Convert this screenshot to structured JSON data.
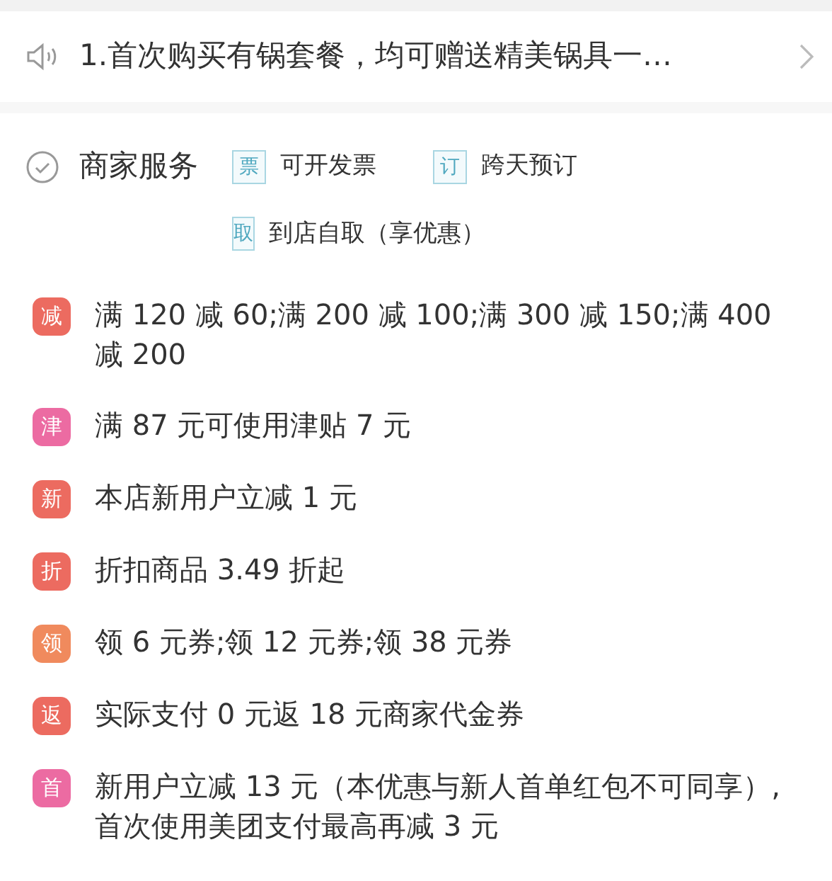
{
  "notice": {
    "text": "1.首次购买有锅套餐，均可赠送精美锅具一…"
  },
  "services": {
    "title": "商家服务",
    "items": [
      {
        "tag": "票",
        "label": "可开发票"
      },
      {
        "tag": "订",
        "label": "跨天预订"
      },
      {
        "tag": "取",
        "label": "到店自取（享优惠）"
      }
    ]
  },
  "promotions": [
    {
      "badge": "减",
      "color": "#ec6b60",
      "text": "满 120 减 60;满 200 减 100;满 300 减 150;满 400 减 200"
    },
    {
      "badge": "津",
      "color": "#ec6ba2",
      "text": "满 87 元可使用津贴 7 元"
    },
    {
      "badge": "新",
      "color": "#ec6b60",
      "text": "本店新用户立减 1 元"
    },
    {
      "badge": "折",
      "color": "#ec6b60",
      "text": "折扣商品 3.49 折起"
    },
    {
      "badge": "领",
      "color": "#f08a5d",
      "text": "领 6 元券;领 12 元券;领 38 元券"
    },
    {
      "badge": "返",
      "color": "#ec6b60",
      "text": "实际支付 0 元返 18 元商家代金券"
    },
    {
      "badge": "首",
      "color": "#ec6ba2",
      "text": "新用户立减 13 元（本优惠与新人首单红包不可同享）,首次使用美团支付最高再减 3 元"
    }
  ]
}
